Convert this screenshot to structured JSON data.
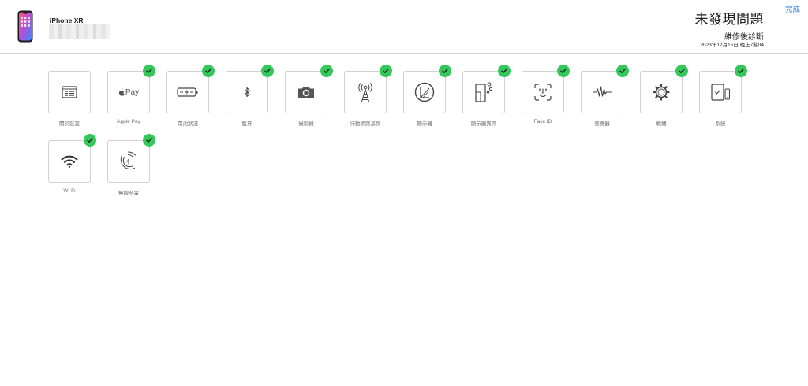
{
  "header": {
    "device_name": "iPhone XR",
    "done": "完成",
    "status_title": "未發現問題",
    "status_subtitle": "維修後診斷",
    "status_date": "2023年12月15日 晚上7點04"
  },
  "colors": {
    "check": "#34c759",
    "link": "#2f7fe0",
    "border": "#cfcfd4",
    "label": "#6e6e73"
  },
  "tiles": [
    {
      "label": "關於裝置",
      "icon": "info-card-icon",
      "checked": false
    },
    {
      "label": "Apple Pay",
      "icon": "apple-pay-icon",
      "checked": true
    },
    {
      "label": "電池狀況",
      "icon": "battery-icon",
      "checked": true
    },
    {
      "label": "藍牙",
      "icon": "bluetooth-icon",
      "checked": true
    },
    {
      "label": "攝影機",
      "icon": "camera-icon",
      "checked": true
    },
    {
      "label": "行動網路基頻",
      "icon": "cellular-tower-icon",
      "checked": true
    },
    {
      "label": "顯示器",
      "icon": "display-icon",
      "checked": true
    },
    {
      "label": "顯示器異常",
      "icon": "display-anomaly-icon",
      "checked": true
    },
    {
      "label": "Face ID",
      "icon": "face-id-icon",
      "checked": true
    },
    {
      "label": "感應器",
      "icon": "sensor-wave-icon",
      "checked": true
    },
    {
      "label": "軟體",
      "icon": "gear-icon",
      "checked": true
    },
    {
      "label": "系統",
      "icon": "system-devices-icon",
      "checked": true
    },
    {
      "label": "Wi-Fi",
      "icon": "wifi-icon",
      "checked": true
    },
    {
      "label": "無線充電",
      "icon": "wireless-charging-icon",
      "checked": true
    }
  ]
}
